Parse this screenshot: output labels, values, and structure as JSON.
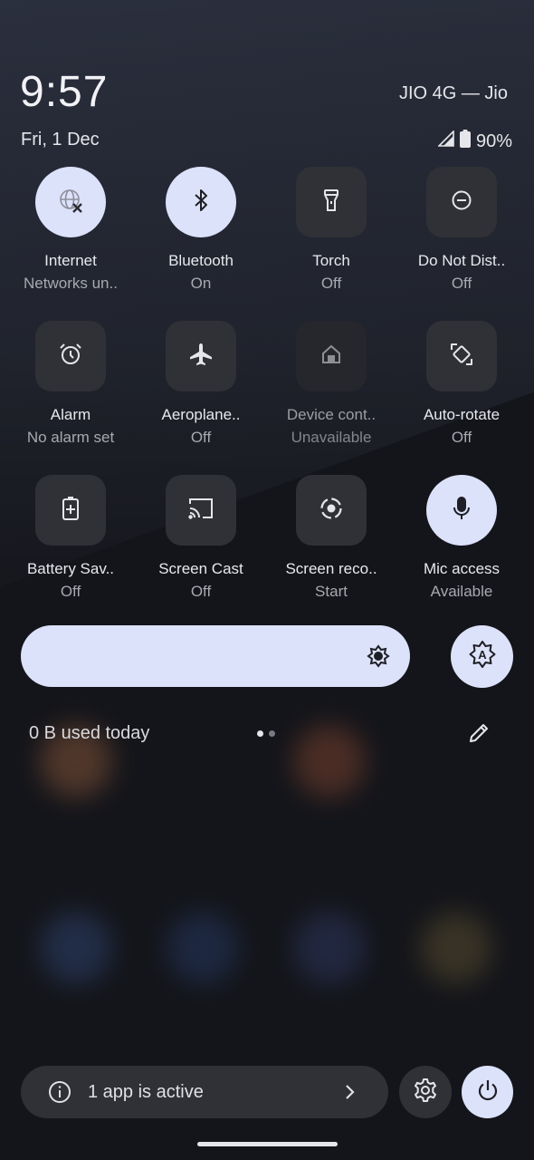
{
  "status_bar": {
    "time": "9:57",
    "date": "Fri, 1 Dec",
    "carrier": "JIO 4G — Jio",
    "battery": "90%",
    "icons": [
      "signal-icon",
      "battery-icon"
    ]
  },
  "tiles": [
    {
      "label": "Internet",
      "sub": "Networks un..",
      "icon": "globe-x-icon",
      "state": "on"
    },
    {
      "label": "Bluetooth",
      "sub": "On",
      "icon": "bluetooth-icon",
      "state": "on"
    },
    {
      "label": "Torch",
      "sub": "Off",
      "icon": "torch-icon",
      "state": "off"
    },
    {
      "label": "Do Not Dist..",
      "sub": "Off",
      "icon": "do-not-disturb-icon",
      "state": "off"
    },
    {
      "label": "Alarm",
      "sub": "No alarm set",
      "icon": "alarm-icon",
      "state": "off"
    },
    {
      "label": "Aeroplane..",
      "sub": "Off",
      "icon": "airplane-icon",
      "state": "off"
    },
    {
      "label": "Device cont..",
      "sub": "Unavailable",
      "icon": "home-icon",
      "state": "unavailable"
    },
    {
      "label": "Auto-rotate",
      "sub": "Off",
      "icon": "rotate-icon",
      "state": "off"
    },
    {
      "label": "Battery Sav..",
      "sub": "Off",
      "icon": "battery-saver-icon",
      "state": "off"
    },
    {
      "label": "Screen Cast",
      "sub": "Off",
      "icon": "cast-icon",
      "state": "off"
    },
    {
      "label": "Screen reco..",
      "sub": "Start",
      "icon": "screen-record-icon",
      "state": "off"
    },
    {
      "label": "Mic access",
      "sub": "Available",
      "icon": "mic-icon",
      "state": "on"
    }
  ],
  "brightness": {
    "icon": "brightness-icon",
    "auto_icon": "auto-brightness-icon",
    "auto_letter": "A"
  },
  "data_usage": {
    "text": "0 B used today"
  },
  "pager": {
    "pages": 2,
    "current": 1
  },
  "footer": {
    "active_apps": "1 app is active",
    "icons": [
      "info-icon",
      "chevron-right-icon",
      "settings-icon",
      "power-icon"
    ]
  },
  "colors": {
    "accent": "#dde2fb",
    "tile_off": "#2f3136",
    "background": "#14151a"
  }
}
